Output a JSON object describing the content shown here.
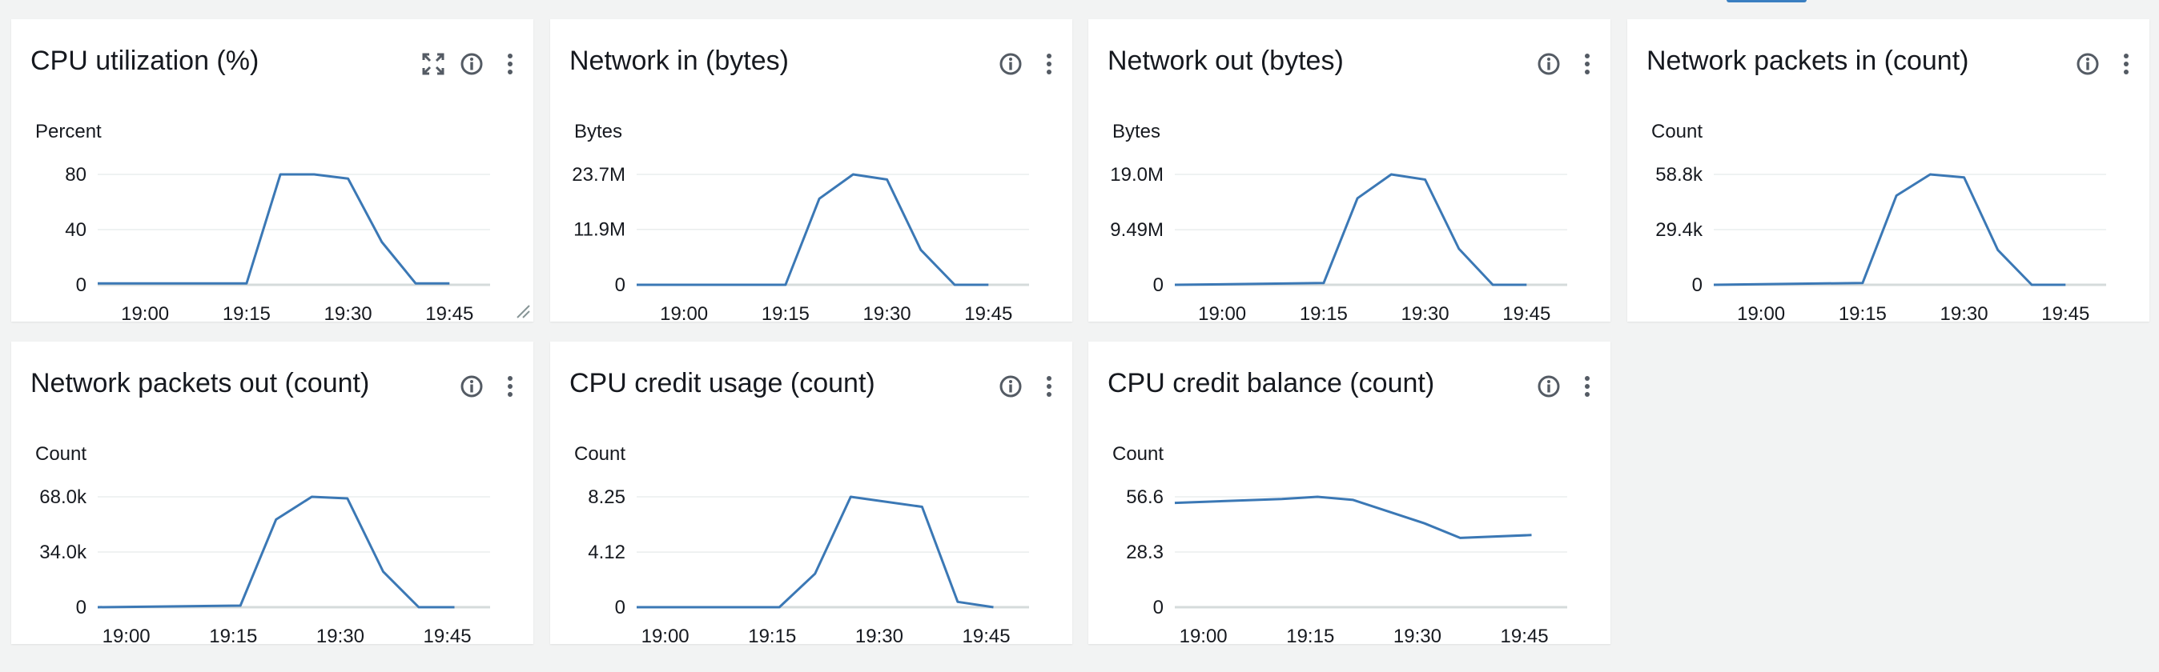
{
  "colors": {
    "line": "#3b78b5",
    "axis": "#d5dbdb",
    "grid": "#eaeded",
    "text": "#16191f",
    "icon": "#545b64"
  },
  "widgets": [
    {
      "title": "CPU utilization (%)",
      "show_expand": true,
      "show_resize": true,
      "chart_data": {
        "type": "line",
        "ylabel": "Percent",
        "ylim": [
          0,
          80
        ],
        "yticks": [
          0,
          40,
          80
        ],
        "ytick_labels": [
          "0",
          "40",
          "80"
        ],
        "xlim": [
          "18:53",
          "19:51"
        ],
        "xticks": [
          "19:00",
          "19:15",
          "19:30",
          "19:45"
        ],
        "x": [
          "18:53",
          "19:15",
          "19:20",
          "19:25",
          "19:30",
          "19:35",
          "19:40",
          "19:45"
        ],
        "values": [
          1,
          1,
          80,
          80,
          77,
          31,
          1,
          1
        ]
      }
    },
    {
      "title": "Network in (bytes)",
      "show_expand": false,
      "show_resize": false,
      "chart_data": {
        "type": "line",
        "ylabel": "Bytes",
        "ylim": [
          0,
          23.7
        ],
        "yticks": [
          0,
          11.9,
          23.7
        ],
        "ytick_labels": [
          "0",
          "11.9M",
          "23.7M"
        ],
        "xlim": [
          "18:53",
          "19:51"
        ],
        "xticks": [
          "19:00",
          "19:15",
          "19:30",
          "19:45"
        ],
        "x": [
          "18:53",
          "19:15",
          "19:20",
          "19:25",
          "19:30",
          "19:35",
          "19:40",
          "19:45"
        ],
        "values": [
          0,
          0,
          18.5,
          23.7,
          22.6,
          7.5,
          0,
          0
        ]
      }
    },
    {
      "title": "Network out (bytes)",
      "show_expand": false,
      "show_resize": false,
      "chart_data": {
        "type": "line",
        "ylabel": "Bytes",
        "ylim": [
          0,
          19.0
        ],
        "yticks": [
          0,
          9.49,
          19.0
        ],
        "ytick_labels": [
          "0",
          "9.49M",
          "19.0M"
        ],
        "xlim": [
          "18:53",
          "19:51"
        ],
        "xticks": [
          "19:00",
          "19:15",
          "19:30",
          "19:45"
        ],
        "x": [
          "18:53",
          "19:15",
          "19:20",
          "19:25",
          "19:30",
          "19:35",
          "19:40",
          "19:45"
        ],
        "values": [
          0,
          0.3,
          14.9,
          19.0,
          18.1,
          6.2,
          0,
          0
        ]
      }
    },
    {
      "title": "Network packets in (count)",
      "show_expand": false,
      "show_resize": false,
      "chart_data": {
        "type": "line",
        "ylabel": "Count",
        "ylim": [
          0,
          58.8
        ],
        "yticks": [
          0,
          29.4,
          58.8
        ],
        "ytick_labels": [
          "0",
          "29.4k",
          "58.8k"
        ],
        "xlim": [
          "18:53",
          "19:51"
        ],
        "xticks": [
          "19:00",
          "19:15",
          "19:30",
          "19:45"
        ],
        "x": [
          "18:53",
          "19:15",
          "19:20",
          "19:25",
          "19:30",
          "19:35",
          "19:40",
          "19:45"
        ],
        "values": [
          0,
          1,
          47.5,
          58.8,
          57.2,
          18.5,
          0,
          0
        ]
      }
    },
    {
      "title": "Network packets out (count)",
      "show_expand": false,
      "show_resize": false,
      "chart_data": {
        "type": "line",
        "ylabel": "Count",
        "ylim": [
          0,
          68.0
        ],
        "yticks": [
          0,
          34.0,
          68.0
        ],
        "ytick_labels": [
          "0",
          "34.0k",
          "68.0k"
        ],
        "xlim": [
          "18:56",
          "19:51"
        ],
        "xticks": [
          "19:00",
          "19:15",
          "19:30",
          "19:45"
        ],
        "x": [
          "18:56",
          "19:16",
          "19:21",
          "19:26",
          "19:31",
          "19:36",
          "19:41",
          "19:46"
        ],
        "values": [
          0,
          1,
          54,
          68.0,
          67,
          22,
          0,
          0
        ]
      }
    },
    {
      "title": "CPU credit usage (count)",
      "show_expand": false,
      "show_resize": false,
      "chart_data": {
        "type": "line",
        "ylabel": "Count",
        "ylim": [
          0,
          8.25
        ],
        "yticks": [
          0,
          4.12,
          8.25
        ],
        "ytick_labels": [
          "0",
          "4.12",
          "8.25"
        ],
        "xlim": [
          "18:56",
          "19:51"
        ],
        "xticks": [
          "19:00",
          "19:15",
          "19:30",
          "19:45"
        ],
        "x": [
          "18:56",
          "19:16",
          "19:21",
          "19:26",
          "19:36",
          "19:41",
          "19:46"
        ],
        "values": [
          0,
          0,
          2.5,
          8.25,
          7.5,
          0.4,
          0
        ]
      }
    },
    {
      "title": "CPU credit balance (count)",
      "show_expand": false,
      "show_resize": false,
      "chart_data": {
        "type": "line",
        "ylabel": "Count",
        "ylim": [
          0,
          56.6
        ],
        "yticks": [
          0,
          28.3,
          56.6
        ],
        "ytick_labels": [
          "0",
          "28.3",
          "56.6"
        ],
        "xlim": [
          "18:56",
          "19:51"
        ],
        "xticks": [
          "19:00",
          "19:15",
          "19:30",
          "19:45"
        ],
        "x": [
          "18:56",
          "19:11",
          "19:16",
          "19:21",
          "19:31",
          "19:36",
          "19:46"
        ],
        "values": [
          53.5,
          55.5,
          56.6,
          55,
          43,
          35.5,
          37
        ]
      }
    }
  ]
}
